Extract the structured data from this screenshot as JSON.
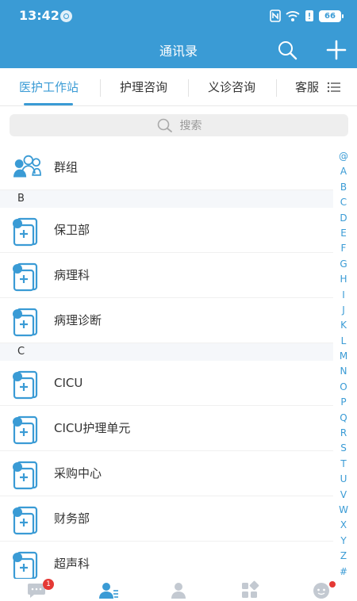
{
  "status": {
    "time": "13:42",
    "battery": "66"
  },
  "header": {
    "title": "通讯录"
  },
  "tabs": [
    {
      "label": "医护工作站",
      "active": true
    },
    {
      "label": "护理咨询",
      "active": false
    },
    {
      "label": "义诊咨询",
      "active": false
    },
    {
      "label": "客服",
      "active": false
    }
  ],
  "search": {
    "placeholder": "搜索"
  },
  "group": {
    "label": "群组"
  },
  "sections": [
    {
      "letter": "B",
      "items": [
        "保卫部",
        "病理科",
        "病理诊断"
      ]
    },
    {
      "letter": "C",
      "items": [
        "CICU",
        "CICU护理单元",
        "采购中心",
        "财务部",
        "超声科"
      ]
    }
  ],
  "index_letters": [
    "@",
    "A",
    "B",
    "C",
    "D",
    "E",
    "F",
    "G",
    "H",
    "I",
    "J",
    "K",
    "L",
    "M",
    "N",
    "O",
    "P",
    "Q",
    "R",
    "S",
    "T",
    "U",
    "V",
    "W",
    "X",
    "Y",
    "Z",
    "#"
  ],
  "bottom_nav": {
    "messages_badge": "1",
    "items": [
      "chat-icon",
      "contacts-icon",
      "person-icon",
      "apps-icon",
      "profile-icon"
    ]
  },
  "colors": {
    "primary": "#3a9bd5",
    "badge": "#e53935"
  }
}
